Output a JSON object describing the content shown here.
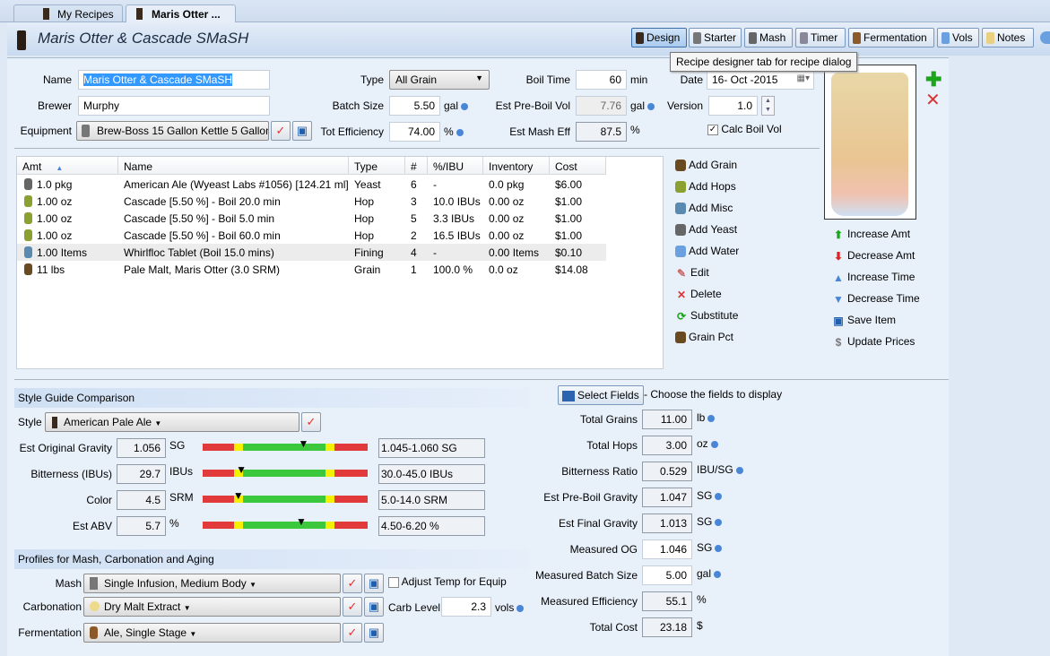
{
  "tabs": [
    {
      "label": "My Recipes"
    },
    {
      "label": "Maris Otter ...",
      "close": "×"
    }
  ],
  "title": "Maris Otter & Cascade SMaSH",
  "toolbar": [
    {
      "label": "Design",
      "icon": "beer-glass-icon",
      "selected": true
    },
    {
      "label": "Starter",
      "icon": "flask-icon"
    },
    {
      "label": "Mash",
      "icon": "mash-tun-icon"
    },
    {
      "label": "Timer",
      "icon": "clock-icon"
    },
    {
      "label": "Fermentation",
      "icon": "fermenter-icon"
    },
    {
      "label": "Vols",
      "icon": "water-drop-icon"
    },
    {
      "label": "Notes",
      "icon": "notes-icon"
    }
  ],
  "tooltip": "Recipe designer tab for recipe dialog",
  "form": {
    "name_label": "Name",
    "name": "Maris Otter & Cascade SMaSH",
    "brewer_label": "Brewer",
    "brewer": "Murphy",
    "equipment_label": "Equipment",
    "equipment": "Brew-Boss 15 Gallon Kettle 5 Gallon Batch",
    "type_label": "Type",
    "type": "All Grain",
    "batch_label": "Batch Size",
    "batch": "5.50",
    "batch_unit": "gal",
    "eff_label": "Tot Efficiency",
    "eff": "74.00",
    "eff_unit": "%",
    "boil_label": "Boil Time",
    "boil": "60",
    "boil_unit": "min",
    "preboil_label": "Est Pre-Boil Vol",
    "preboil": "7.76",
    "preboil_unit": "gal",
    "masheff_label": "Est Mash Eff",
    "masheff": "87.5",
    "masheff_unit": "%",
    "date_label": "Date",
    "date": "16- Oct -2015",
    "version_label": "Version",
    "version": "1.0",
    "calc_label": "Calc Boil Vol",
    "calc_checked": true
  },
  "ingredients": {
    "columns": [
      "Amt",
      "Name",
      "Type",
      "#",
      "%/IBU",
      "Inventory",
      "Cost"
    ],
    "rows": [
      {
        "icon": "yeast-icon",
        "amt": "1.0 pkg",
        "name": "American Ale (Wyeast Labs #1056) [124.21 ml]",
        "type": "Yeast",
        "num": "6",
        "pct": "-",
        "inv": "0.0 pkg",
        "cost": "$6.00"
      },
      {
        "icon": "hop-icon",
        "amt": "1.00 oz",
        "name": "Cascade [5.50 %] - Boil 20.0 min",
        "type": "Hop",
        "num": "3",
        "pct": "10.0 IBUs",
        "inv": "0.00 oz",
        "cost": "$1.00"
      },
      {
        "icon": "hop-icon",
        "amt": "1.00 oz",
        "name": "Cascade [5.50 %] - Boil 5.0 min",
        "type": "Hop",
        "num": "5",
        "pct": "3.3 IBUs",
        "inv": "0.00 oz",
        "cost": "$1.00"
      },
      {
        "icon": "hop-icon",
        "amt": "1.00 oz",
        "name": "Cascade [5.50 %] - Boil 60.0 min",
        "type": "Hop",
        "num": "2",
        "pct": "16.5 IBUs",
        "inv": "0.00 oz",
        "cost": "$1.00"
      },
      {
        "icon": "misc-icon",
        "amt": "1.00 Items",
        "name": "Whirlfloc Tablet (Boil 15.0 mins)",
        "type": "Fining",
        "num": "4",
        "pct": "-",
        "inv": "0.00 Items",
        "cost": "$0.10"
      },
      {
        "icon": "grain-icon",
        "amt": "11 lbs",
        "name": "Pale Malt, Maris Otter (3.0 SRM)",
        "type": "Grain",
        "num": "1",
        "pct": "100.0 %",
        "inv": "0.0 oz",
        "cost": "$14.08"
      }
    ]
  },
  "actions": [
    {
      "label": "Add Grain",
      "icon": "grain-icon"
    },
    {
      "label": "Add Hops",
      "icon": "hop-icon"
    },
    {
      "label": "Add Misc",
      "icon": "misc-icon"
    },
    {
      "label": "Add Yeast",
      "icon": "yeast-icon"
    },
    {
      "label": "Add Water",
      "icon": "water-drop-icon"
    },
    {
      "label": "Edit",
      "icon": "edit-icon"
    },
    {
      "label": "Delete",
      "icon": "delete-icon"
    },
    {
      "label": "Substitute",
      "icon": "substitute-icon"
    },
    {
      "label": "Grain Pct",
      "icon": "grain-icon"
    }
  ],
  "actions2": [
    {
      "label": "Increase Amt",
      "icon": "arrow-up-icon"
    },
    {
      "label": "Decrease Amt",
      "icon": "arrow-down-icon"
    },
    {
      "label": "Increase Time",
      "icon": "triangle-up-icon"
    },
    {
      "label": "Decrease Time",
      "icon": "triangle-down-icon"
    },
    {
      "label": "Save Item",
      "icon": "save-icon"
    },
    {
      "label": "Update Prices",
      "icon": "dollar-icon"
    }
  ],
  "style": {
    "section": "Style Guide Comparison",
    "style_label": "Style",
    "style": "American Pale Ale",
    "rows": [
      {
        "label": "Est Original Gravity",
        "value": "1.056",
        "unit": "SG",
        "range": "1.045-1.060 SG",
        "v": 1.056,
        "min": 1.045,
        "max": 1.06
      },
      {
        "label": "Bitterness (IBUs)",
        "value": "29.7",
        "unit": "IBUs",
        "range": "30.0-45.0 IBUs",
        "v": 29.7,
        "min": 30,
        "max": 45
      },
      {
        "label": "Color",
        "value": "4.5",
        "unit": "SRM",
        "range": "5.0-14.0 SRM",
        "v": 4.5,
        "min": 5,
        "max": 14
      },
      {
        "label": "Est ABV",
        "value": "5.7",
        "unit": "%",
        "range": "4.50-6.20 %",
        "v": 5.7,
        "min": 4.5,
        "max": 6.2
      }
    ]
  },
  "profiles": {
    "section": "Profiles for Mash, Carbonation and Aging",
    "mash_label": "Mash",
    "mash": "Single Infusion, Medium Body",
    "adjust_label": "Adjust Temp for Equip",
    "adjust_checked": false,
    "carb_label": "Carbonation",
    "carb": "Dry Malt Extract",
    "carblevel_label": "Carb Level",
    "carblevel": "2.3",
    "carblevel_unit": "vols",
    "ferm_label": "Fermentation",
    "ferm": "Ale, Single Stage"
  },
  "stats": {
    "select_label": "Select Fields",
    "select_hint": "- Choose the fields to display",
    "rows": [
      {
        "label": "Total Grains",
        "value": "11.00",
        "unit": "lb",
        "dot": true,
        "edit": false
      },
      {
        "label": "Total Hops",
        "value": "3.00",
        "unit": "oz",
        "dot": true,
        "edit": false
      },
      {
        "label": "Bitterness Ratio",
        "value": "0.529",
        "unit": "IBU/SG",
        "dot": true,
        "edit": false
      },
      {
        "label": "Est Pre-Boil Gravity",
        "value": "1.047",
        "unit": "SG",
        "dot": true,
        "edit": false
      },
      {
        "label": "Est Final Gravity",
        "value": "1.013",
        "unit": "SG",
        "dot": true,
        "edit": false
      },
      {
        "label": "Measured OG",
        "value": "1.046",
        "unit": "SG",
        "dot": true,
        "edit": true
      },
      {
        "label": "Measured Batch Size",
        "value": "5.00",
        "unit": "gal",
        "dot": true,
        "edit": true
      },
      {
        "label": "Measured Efficiency",
        "value": "55.1",
        "unit": "%",
        "dot": false,
        "edit": false
      },
      {
        "label": "Total Cost",
        "value": "23.18",
        "unit": "$",
        "dot": false,
        "edit": false
      }
    ]
  },
  "colors": {
    "bar_red": "#e23a3a",
    "bar_yellow": "#f5f000",
    "bar_green": "#3cc83c",
    "accent": "#4a86d8"
  }
}
